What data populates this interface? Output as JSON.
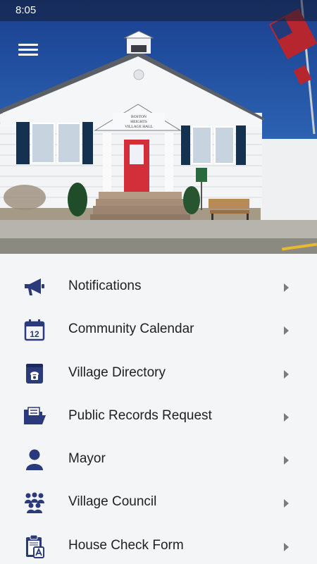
{
  "status_bar": {
    "time": "8:05"
  },
  "hero": {
    "sign_text": [
      "BOSTON",
      "HEIGHTS",
      "VILLAGE HALL"
    ]
  },
  "colors": {
    "accent": "#2b3a7a",
    "door": "#d32f3a"
  },
  "menu": {
    "items": [
      {
        "label": "Notifications",
        "icon": "megaphone-icon"
      },
      {
        "label": "Community Calendar",
        "icon": "calendar-icon"
      },
      {
        "label": "Village Directory",
        "icon": "phone-directory-icon"
      },
      {
        "label": "Public Records Request",
        "icon": "folder-icon"
      },
      {
        "label": "Mayor",
        "icon": "person-icon"
      },
      {
        "label": "Village Council",
        "icon": "group-icon"
      },
      {
        "label": "House Check Form",
        "icon": "clipboard-icon"
      }
    ],
    "calendar_day": "12"
  }
}
